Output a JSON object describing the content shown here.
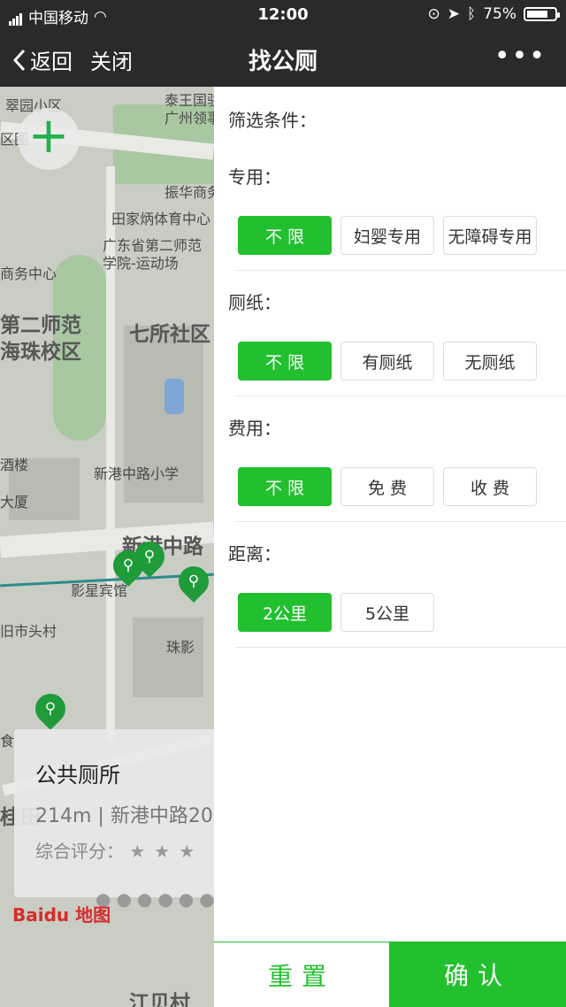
{
  "status_bar": {
    "carrier": "中国移动",
    "time": "12:00",
    "battery": "75%",
    "battery_level": 0.75
  },
  "nav": {
    "back_label": "返回",
    "close_label": "关闭",
    "title": "找公厕",
    "more_label": "•••"
  },
  "map": {
    "zoom_in_label": "+",
    "labels": [
      "翠园小区",
      "泰王国驻",
      "广州领事",
      "区图",
      "振华商务",
      "田家炳体育中心",
      "广东省第二师范",
      "学院-运动场",
      "商务中心",
      "第二师范",
      "海珠校区",
      "七所社区",
      "酒楼",
      "新港中路小学",
      "大厦",
      "新港中路",
      "影星宾馆",
      "旧市头村",
      "珠影",
      "食",
      "桂田",
      "江贝村"
    ],
    "pin_glyph": "⚲",
    "card": {
      "name": "公共厕所",
      "meta": "214m | 新港中路20",
      "rating_label": "综合评分：",
      "stars": "★★★",
      "rating": 0
    },
    "pager_dots": "●●●●●●●",
    "brand": "Baidu 地图"
  },
  "filter": {
    "heading": "筛选条件：",
    "sections": [
      {
        "label": "专用：",
        "options": [
          "不 限",
          "妇婴专用",
          "无障碍专用"
        ],
        "selected": 0
      },
      {
        "label": "厕纸：",
        "options": [
          "不 限",
          "有厕纸",
          "无厕纸"
        ],
        "selected": 0
      },
      {
        "label": "费用：",
        "options": [
          "不 限",
          "免 费",
          "收 费"
        ],
        "selected": 0
      },
      {
        "label": "距离：",
        "options": [
          "2公里",
          "5公里"
        ],
        "selected": 0
      }
    ]
  },
  "footer": {
    "reset_label": "重置",
    "confirm_label": "确认"
  },
  "colors": {
    "accent": "#22c02f",
    "nav_bg": "#2a2a2a",
    "pin": "#1f9b3a"
  }
}
